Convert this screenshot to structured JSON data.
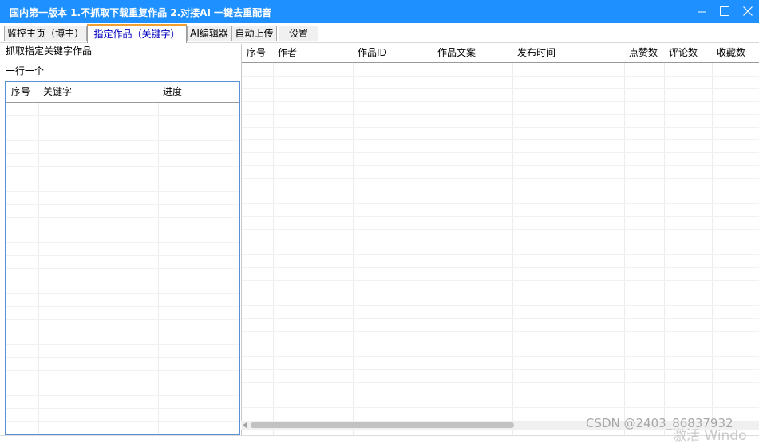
{
  "window": {
    "title": "国内第一版本 1.不抓取下载重复作品 2.对接AI 一键去重配音"
  },
  "tabs": [
    {
      "label": "监控主页（博主）",
      "active": false
    },
    {
      "label": "指定作品（关键字）",
      "active": true
    },
    {
      "label": "AI编辑器",
      "active": false
    },
    {
      "label": "自动上传",
      "active": false
    },
    {
      "label": "设置",
      "active": false
    }
  ],
  "left_panel": {
    "heading": "抓取指定关键字作品",
    "hint": "一行一个",
    "columns": [
      "序号",
      "关键字",
      "进度"
    ]
  },
  "works_table": {
    "columns": [
      "序号",
      "作者",
      "作品ID",
      "作品文案",
      "发布时间",
      "点赞数",
      "评论数",
      "收藏数"
    ]
  },
  "watermark": {
    "csdn": "CSDN @2403_86837932",
    "activate": "激活 Windo"
  },
  "colors": {
    "titlebar": "#1e90ff",
    "active_tab_text": "#0000c0",
    "active_tab_accent": "#f0a030",
    "list_border": "#5b8fd6"
  }
}
